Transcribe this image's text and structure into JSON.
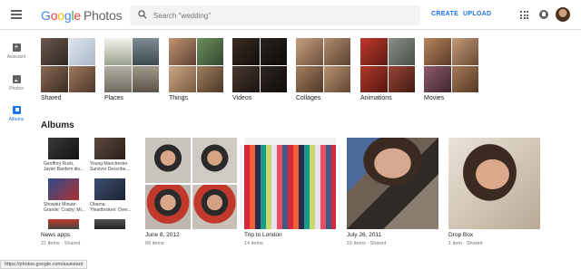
{
  "header": {
    "logo_google": [
      "G",
      "o",
      "o",
      "g",
      "l",
      "e"
    ],
    "logo_colors": [
      "#4285F4",
      "#EA4335",
      "#FBBC05",
      "#4285F4",
      "#34A853",
      "#EA4335"
    ],
    "logo_photos": "Photos",
    "search_placeholder": "Search \"wedding\"",
    "create_label": "CREATE",
    "upload_label": "UPLOAD",
    "accent": "#1a73e8"
  },
  "sidebar": {
    "items": [
      {
        "label": "Assistant",
        "icon": "assistant-icon"
      },
      {
        "label": "Photos",
        "icon": "photos-icon"
      },
      {
        "label": "Albums",
        "icon": "albums-icon",
        "active": true
      }
    ]
  },
  "categories": [
    {
      "label": "Shared"
    },
    {
      "label": "Places"
    },
    {
      "label": "Things"
    },
    {
      "label": "Videos"
    },
    {
      "label": "Collages"
    },
    {
      "label": "Animations"
    },
    {
      "label": "Movies"
    }
  ],
  "albums_title": "Albums",
  "albums": [
    {
      "name": "News apps",
      "meta": "21 items · Shared"
    },
    {
      "name": "June 8, 2012",
      "meta": "68 items"
    },
    {
      "name": "Trip to London",
      "meta": "14 items"
    },
    {
      "name": "July 26, 2011",
      "meta": "16 items · Shared"
    },
    {
      "name": "Drop Box",
      "meta": "1 item · Shared"
    }
  ],
  "news_items": [
    {
      "caption": "Geoffrey Rush, Javier Bardem dis..."
    },
    {
      "caption": "Young Manchester Survivor Describe..."
    },
    {
      "caption": "Showbiz Minute: Grande; Cosby; Mi..."
    },
    {
      "caption": "Obama: 'Heartbroken' Over..."
    }
  ],
  "status_url": "https://photos.google.com/assistant"
}
